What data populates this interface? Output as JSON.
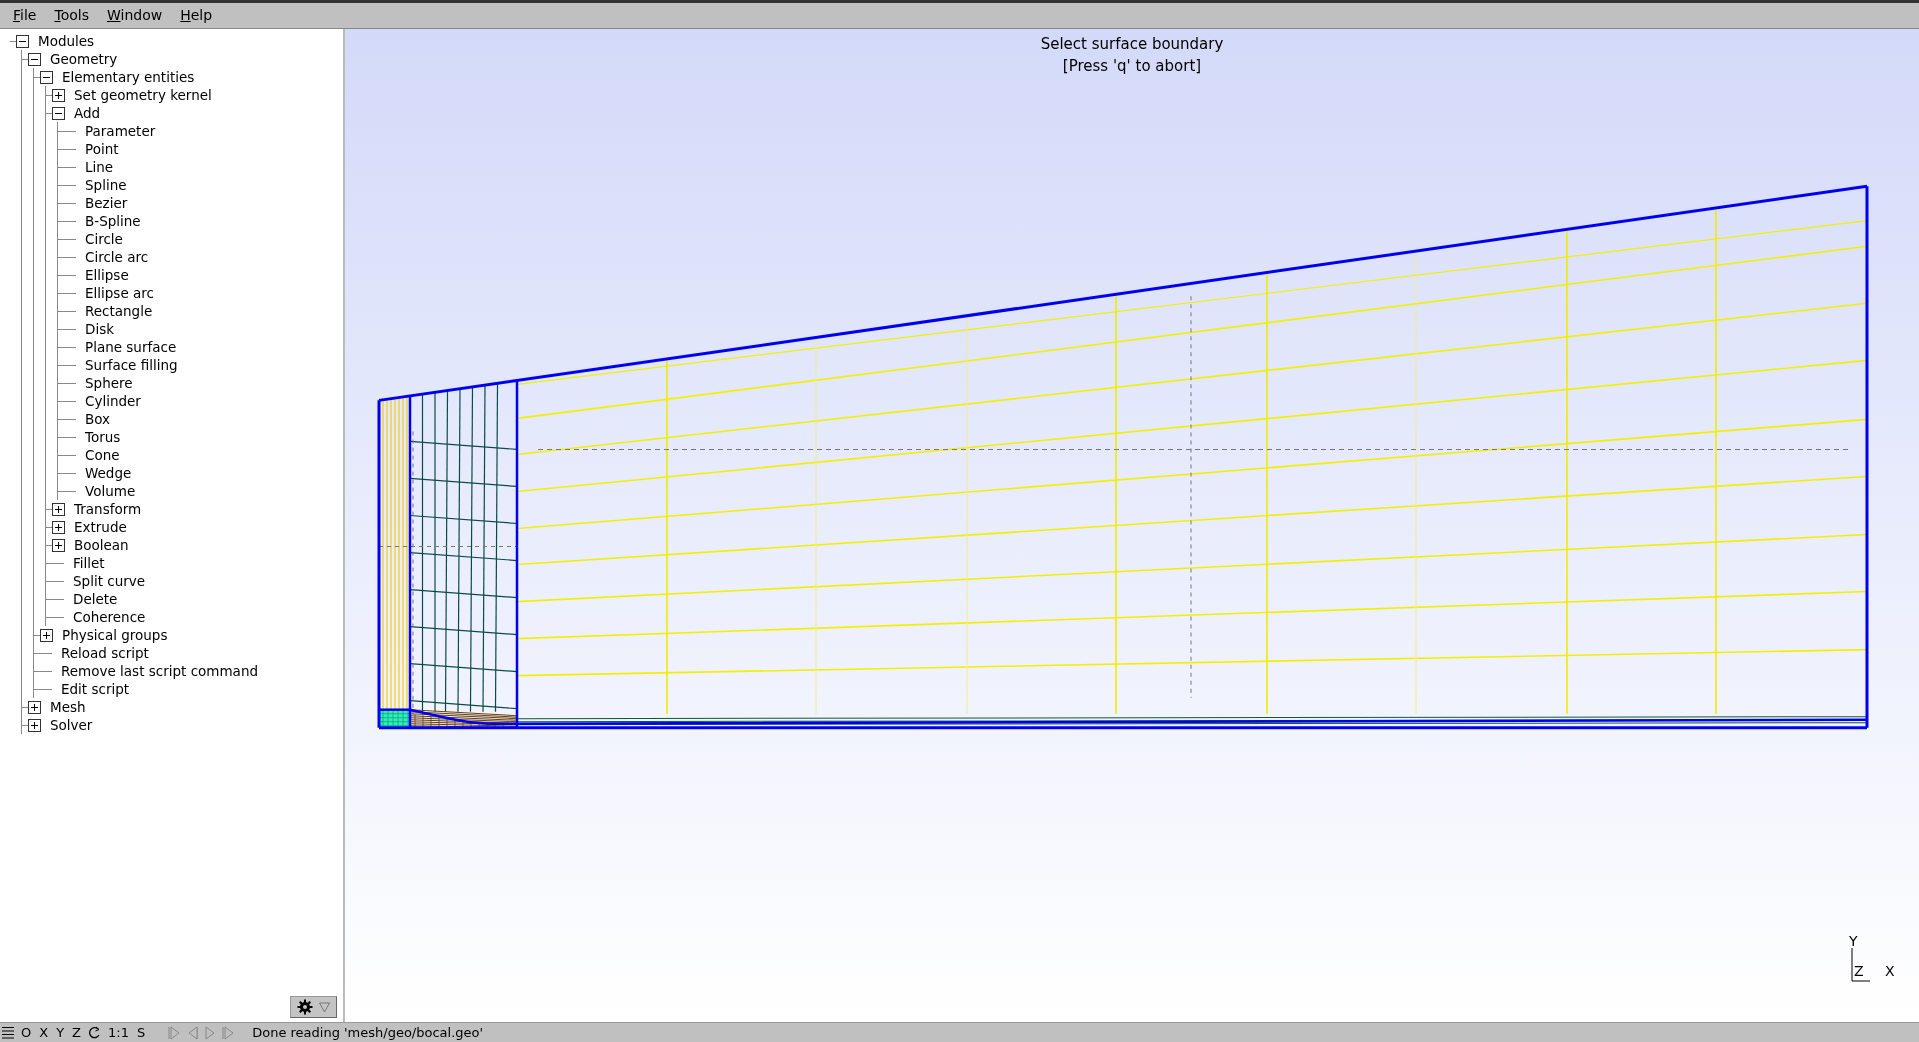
{
  "menu": [
    {
      "label": "File"
    },
    {
      "label": "Tools"
    },
    {
      "label": "Window"
    },
    {
      "label": "Help"
    }
  ],
  "tree": [
    {
      "label": "Modules",
      "expanded": true,
      "children": [
        {
          "label": "Geometry",
          "expanded": true,
          "children": [
            {
              "label": "Elementary entities",
              "expanded": true,
              "children": [
                {
                  "label": "Set geometry kernel",
                  "expanded": false
                },
                {
                  "label": "Add",
                  "expanded": true,
                  "children": [
                    {
                      "label": "Parameter"
                    },
                    {
                      "label": "Point"
                    },
                    {
                      "label": "Line"
                    },
                    {
                      "label": "Spline"
                    },
                    {
                      "label": "Bezier"
                    },
                    {
                      "label": "B-Spline"
                    },
                    {
                      "label": "Circle"
                    },
                    {
                      "label": "Circle arc"
                    },
                    {
                      "label": "Ellipse"
                    },
                    {
                      "label": "Ellipse arc"
                    },
                    {
                      "label": "Rectangle"
                    },
                    {
                      "label": "Disk"
                    },
                    {
                      "label": "Plane surface"
                    },
                    {
                      "label": "Surface filling"
                    },
                    {
                      "label": "Sphere"
                    },
                    {
                      "label": "Cylinder"
                    },
                    {
                      "label": "Box"
                    },
                    {
                      "label": "Torus"
                    },
                    {
                      "label": "Cone"
                    },
                    {
                      "label": "Wedge"
                    },
                    {
                      "label": "Volume"
                    }
                  ]
                },
                {
                  "label": "Transform",
                  "expanded": false
                },
                {
                  "label": "Extrude",
                  "expanded": false
                },
                {
                  "label": "Boolean",
                  "expanded": false
                },
                {
                  "label": "Fillet"
                },
                {
                  "label": "Split curve"
                },
                {
                  "label": "Delete"
                },
                {
                  "label": "Coherence"
                }
              ]
            },
            {
              "label": "Physical groups",
              "expanded": false
            },
            {
              "label": "Reload script"
            },
            {
              "label": "Remove last script command"
            },
            {
              "label": "Edit script"
            }
          ]
        },
        {
          "label": "Mesh",
          "expanded": false
        },
        {
          "label": "Solver",
          "expanded": false
        }
      ]
    }
  ],
  "viewport": {
    "prompt": [
      "Select surface boundary",
      "[Press 'q' to abort]"
    ],
    "axes": {
      "y": "Y",
      "z": "Z",
      "x": "X"
    }
  },
  "status_bar": {
    "buttons": [
      "O",
      "X",
      "Y",
      "Z",
      "1:1",
      "S"
    ],
    "message": "Done reading 'mesh/geo/bocal.geo'"
  }
}
